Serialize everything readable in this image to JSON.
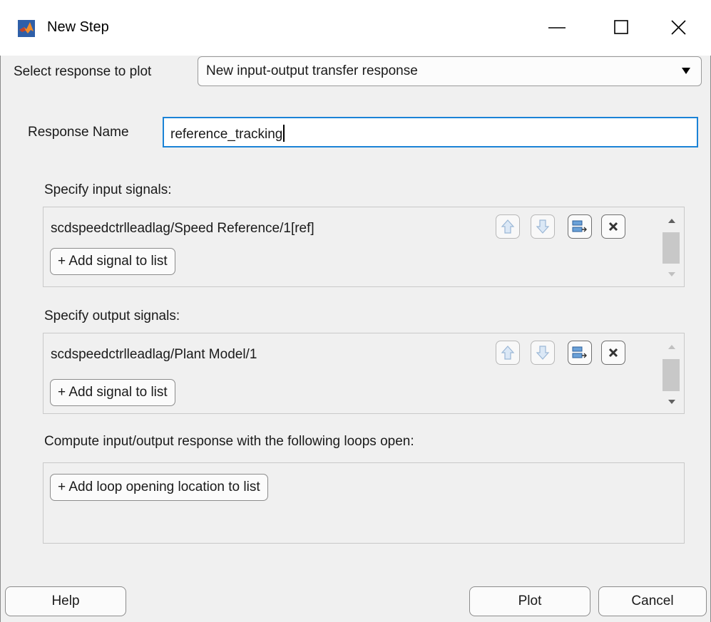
{
  "window": {
    "title": "New Step",
    "icon": "matlab-logo-icon",
    "controls": [
      "minimize-icon",
      "maximize-icon",
      "close-icon"
    ]
  },
  "response_select": {
    "label": "Select response to plot",
    "value": "New input-output transfer response"
  },
  "response_name": {
    "label": "Response Name",
    "value": "reference_tracking"
  },
  "inputs": {
    "heading": "Specify input signals:",
    "signals": [
      "scdspeedctrlleadlag/Speed Reference/1[ref]"
    ],
    "add_label": "+ Add signal to list"
  },
  "outputs": {
    "heading": "Specify output signals:",
    "signals": [
      "scdspeedctrlleadlag/Plant Model/1"
    ],
    "add_label": "+ Add signal to list"
  },
  "loops": {
    "heading": "Compute input/output response with the following loops open:",
    "add_label": "+ Add loop opening location to list"
  },
  "buttons": {
    "help": "Help",
    "plot": "Plot",
    "cancel": "Cancel"
  },
  "colors": {
    "focus_border": "#1b83d6",
    "background": "#f0f0f0"
  }
}
